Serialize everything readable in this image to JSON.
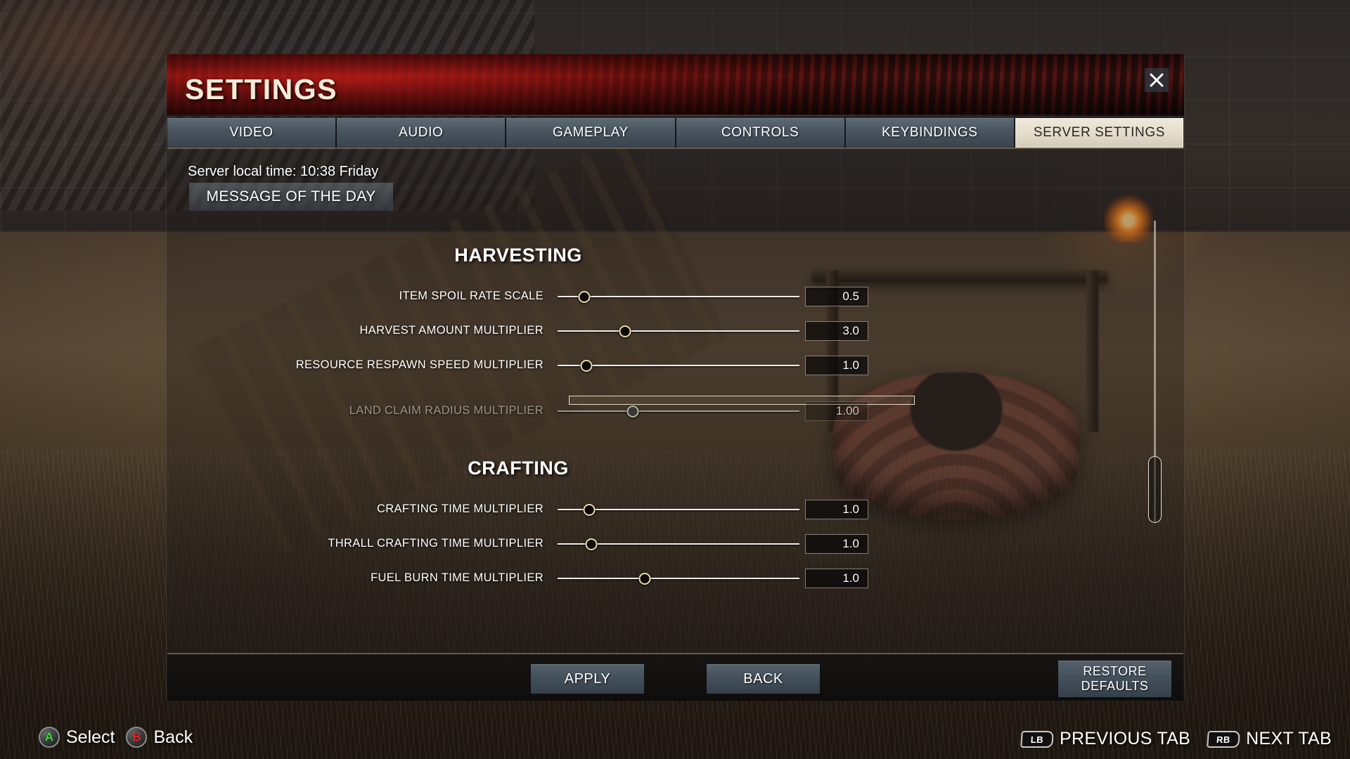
{
  "window": {
    "title": "SETTINGS",
    "close_icon": "close-icon"
  },
  "tabs": [
    {
      "label": "VIDEO",
      "active": false
    },
    {
      "label": "AUDIO",
      "active": false
    },
    {
      "label": "GAMEPLAY",
      "active": false
    },
    {
      "label": "CONTROLS",
      "active": false
    },
    {
      "label": "KEYBINDINGS",
      "active": false
    },
    {
      "label": "SERVER SETTINGS",
      "active": true
    }
  ],
  "server": {
    "local_time_label": "Server local time: 10:38  Friday",
    "motd_button": "MESSAGE OF THE DAY"
  },
  "sections": [
    {
      "title": "HARVESTING",
      "rows": [
        {
          "label": "ITEM SPOIL RATE SCALE",
          "value": "0.5",
          "fill": 0.11,
          "disabled": false
        },
        {
          "label": "HARVEST AMOUNT MULTIPLIER",
          "value": "3.0",
          "fill": 0.28,
          "disabled": false
        },
        {
          "label": "RESOURCE RESPAWN SPEED MULTIPLIER",
          "value": "1.0",
          "fill": 0.12,
          "disabled": false
        },
        {
          "label": "LAND CLAIM RADIUS MULTIPLIER",
          "value": "1.00",
          "fill": 0.31,
          "disabled": true
        }
      ]
    },
    {
      "title": "CRAFTING",
      "rows": [
        {
          "label": "CRAFTING TIME MULTIPLIER",
          "value": "1.0",
          "fill": 0.13,
          "disabled": false
        },
        {
          "label": "THRALL CRAFTING TIME MULTIPLIER",
          "value": "1.0",
          "fill": 0.14,
          "disabled": false
        },
        {
          "label": "FUEL BURN TIME MULTIPLIER",
          "value": "1.0",
          "fill": 0.36,
          "disabled": false
        }
      ]
    }
  ],
  "footer_buttons": {
    "apply": "APPLY",
    "back": "BACK",
    "restore_defaults_line1": "RESTORE",
    "restore_defaults_line2": "DEFAULTS"
  },
  "hud": {
    "select_button": "A",
    "select_label": "Select",
    "back_button": "B",
    "back_label": "Back",
    "prev_tab_button": "LB",
    "prev_tab_label": "PREVIOUS TAB",
    "next_tab_button": "RB",
    "next_tab_label": "NEXT TAB"
  },
  "colors": {
    "accent_red": "#7d1512",
    "tab_active_bg": "#e3dccb",
    "button_blue": "#44505b",
    "a_button_green": "#3ddb3d",
    "b_button_red": "#e02b2b"
  }
}
